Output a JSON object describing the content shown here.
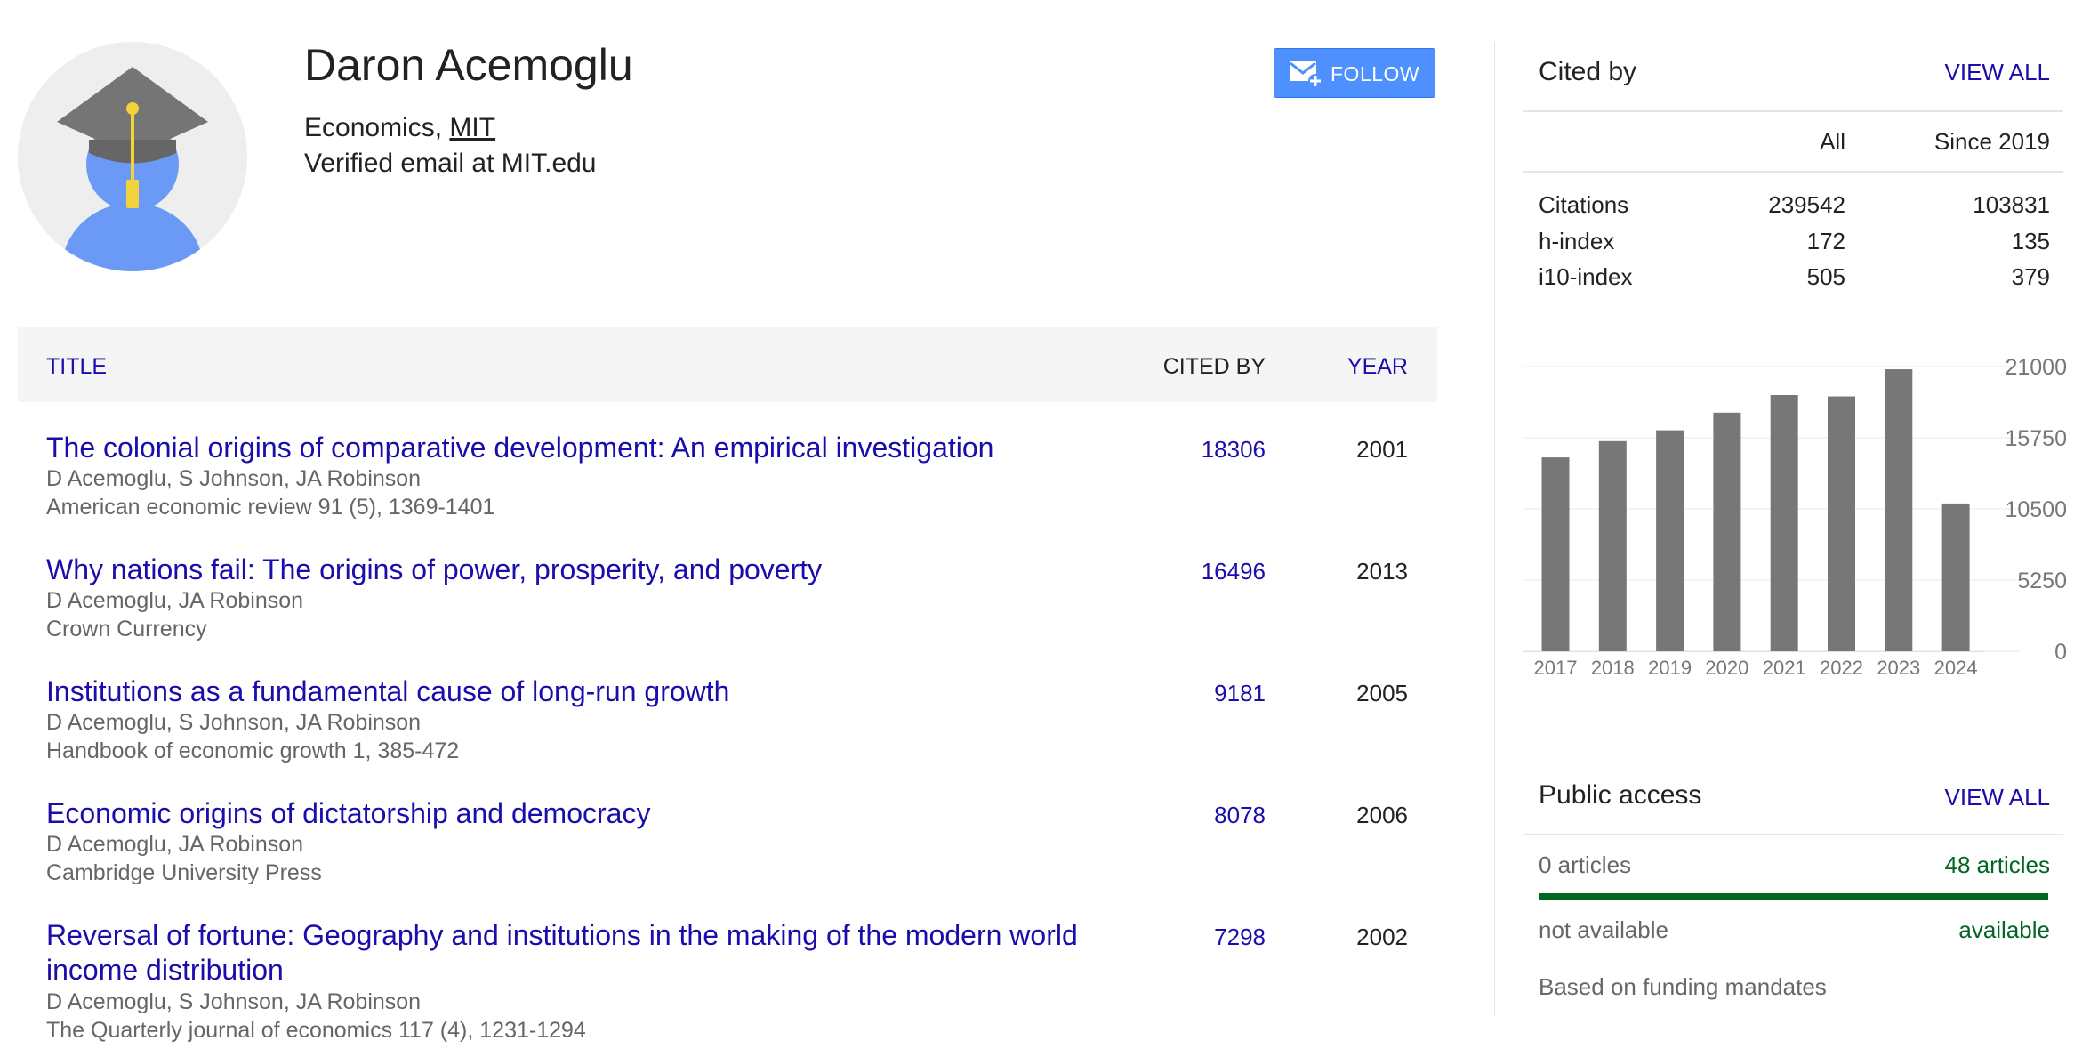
{
  "profile": {
    "name": "Daron Acemoglu",
    "field": "Economics,",
    "institution": "MIT",
    "email": "Verified email at MIT.edu",
    "follow_label": "FOLLOW"
  },
  "table": {
    "headers": {
      "title": "TITLE",
      "cited_by": "CITED BY",
      "year": "YEAR"
    },
    "rows": [
      {
        "title": "The colonial origins of comparative development: An empirical investigation",
        "authors": "D Acemoglu, S Johnson, JA Robinson",
        "venue": "American economic review 91 (5), 1369-1401",
        "cited": "18306",
        "year": "2001"
      },
      {
        "title": "Why nations fail: The origins of power, prosperity, and poverty",
        "authors": "D Acemoglu, JA Robinson",
        "venue": "Crown Currency",
        "cited": "16496",
        "year": "2013"
      },
      {
        "title": "Institutions as a fundamental cause of long-run growth",
        "authors": "D Acemoglu, S Johnson, JA Robinson",
        "venue": "Handbook of economic growth 1, 385-472",
        "cited": "9181",
        "year": "2005"
      },
      {
        "title": "Economic origins of dictatorship and democracy",
        "authors": "D Acemoglu, JA Robinson",
        "venue": "Cambridge University Press",
        "cited": "8078",
        "year": "2006"
      },
      {
        "title": "Reversal of fortune: Geography and institutions in the making of the modern world income distribution",
        "authors": "D Acemoglu, S Johnson, JA Robinson",
        "venue": "The Quarterly journal of economics 117 (4), 1231-1294",
        "cited": "7298",
        "year": "2002"
      }
    ]
  },
  "cited_by": {
    "title": "Cited by",
    "view_all": "VIEW ALL",
    "col_all": "All",
    "col_since": "Since 2019",
    "metrics": [
      {
        "label": "Citations",
        "all": "239542",
        "since": "103831"
      },
      {
        "label": "h-index",
        "all": "172",
        "since": "135"
      },
      {
        "label": "i10-index",
        "all": "505",
        "since": "379"
      }
    ]
  },
  "chart_data": {
    "type": "bar",
    "categories": [
      "2017",
      "2018",
      "2019",
      "2020",
      "2021",
      "2022",
      "2023",
      "2024"
    ],
    "values": [
      14300,
      15500,
      16300,
      17600,
      18900,
      18800,
      20800,
      10900
    ],
    "ylim": [
      0,
      21000
    ],
    "yticks": [
      "21000",
      "15750",
      "10500",
      "5250",
      "0"
    ],
    "bar_color": "#777777",
    "grid": true
  },
  "public_access": {
    "title": "Public access",
    "view_all": "VIEW ALL",
    "left_count": "0 articles",
    "right_count": "48 articles",
    "left_status": "not available",
    "right_status": "available",
    "note": "Based on funding mandates",
    "available_fraction": 1.0,
    "color_available": "#006621"
  },
  "colors": {
    "link": "#1a0dab",
    "button": "#4d90fe"
  }
}
